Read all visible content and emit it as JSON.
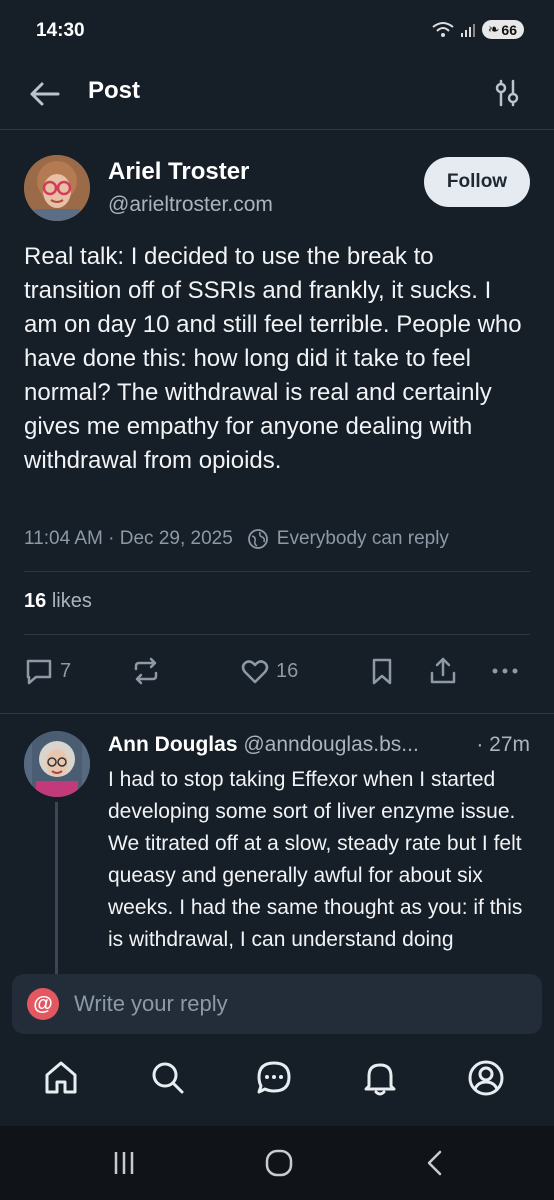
{
  "status_bar": {
    "time": "14:30",
    "battery": "66"
  },
  "header": {
    "title": "Post"
  },
  "post": {
    "author_name": "Ariel Troster",
    "author_handle": "@arieltroster.com",
    "follow_label": "Follow",
    "text": "Real talk: I decided to use the break to transition off of SSRIs and frankly, it sucks. I am on day 10 and still feel terrible. People who have done this: how long did it take to feel normal? The withdrawal is real and certainly gives me empathy for anyone dealing with withdrawal from opioids.",
    "timestamp": "11:04 AM · Dec 29, 2025",
    "reply_setting": "Everybody can reply",
    "likes_count": "16",
    "likes_label": "likes",
    "reply_count": "7",
    "like_count_action": "16"
  },
  "reply": {
    "author_name": "Ann Douglas",
    "author_handle": "@anndouglas.bs...",
    "time": "· 27m",
    "text": "I had to stop taking Effexor when I started developing some sort of liver enzyme issue. We titrated off at a slow, steady rate but I felt queasy and generally awful for about six weeks. I had the same thought as you: if this is withdrawal, I can understand doing"
  },
  "composer": {
    "placeholder": "Write your reply"
  },
  "colors": {
    "background": "#161e27",
    "accent": "#e35760",
    "follow_bg": "#e6ebf1"
  }
}
